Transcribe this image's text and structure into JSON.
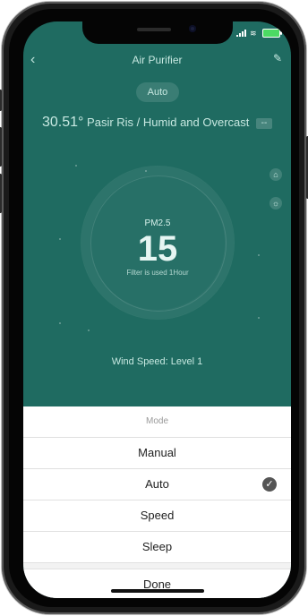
{
  "header": {
    "title": "Air Purifier"
  },
  "mode_pill": {
    "label": "Auto"
  },
  "weather": {
    "temperature": "30.51°",
    "location_and_condition": "Pasir Ris / Humid and Overcast",
    "code": "--"
  },
  "air_quality": {
    "label": "PM2.5",
    "value": "15",
    "filter_text": "Filter is used 1Hour"
  },
  "wind": {
    "label": "Wind Speed: Level 1"
  },
  "mode_sheet": {
    "title": "Mode",
    "options": [
      {
        "label": "Manual",
        "selected": false
      },
      {
        "label": "Auto",
        "selected": true
      },
      {
        "label": "Speed",
        "selected": false
      },
      {
        "label": "Sleep",
        "selected": false
      }
    ],
    "done_label": "Done"
  },
  "colors": {
    "background_top": "#1f6b61",
    "sheet_bg": "#ffffff",
    "accent": "#4cd964"
  },
  "icons": {
    "back": "chevron-left-icon",
    "edit": "pencil-icon",
    "check": "check-icon",
    "mini1": "bell-icon",
    "mini2": "bulb-icon"
  }
}
